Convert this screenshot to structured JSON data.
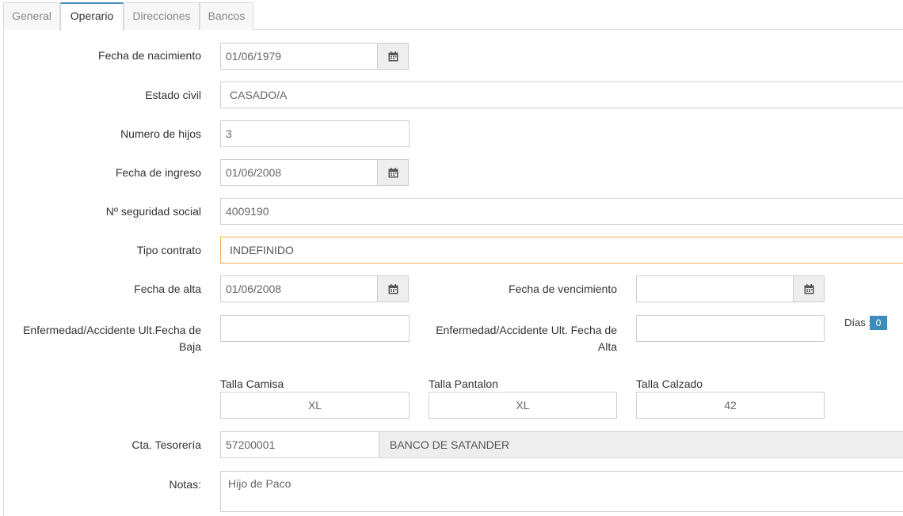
{
  "tabs": [
    "General",
    "Operario",
    "Direcciones",
    "Bancos"
  ],
  "fields": {
    "fecha_nacimiento": {
      "label": "Fecha de nacimiento",
      "value": "01/06/1979"
    },
    "estado_civil": {
      "label": "Estado civil",
      "value": "CASADO/A"
    },
    "numero_hijos": {
      "label": "Numero de hijos",
      "value": "3"
    },
    "fecha_ingreso": {
      "label": "Fecha de ingreso",
      "value": "01/06/2008"
    },
    "seguridad_social": {
      "label": "Nº seguridad social",
      "value": "4009190"
    },
    "tipo_contrato": {
      "label": "Tipo contrato",
      "value": "INDEFINIDO"
    },
    "fecha_alta": {
      "label": "Fecha de alta",
      "value": "01/06/2008"
    },
    "fecha_vencimiento": {
      "label": "Fecha de vencimiento",
      "value": ""
    },
    "enf_baja": {
      "label_1": "Enfermedad/Accidente Ult.Fecha de",
      "label_2": "Baja",
      "value": ""
    },
    "enf_alta": {
      "label_1": "Enfermedad/Accidente Ult. Fecha de",
      "label_2": "Alta",
      "value": ""
    },
    "dias": {
      "label": "Días :",
      "value": "0"
    },
    "talla_camisa": {
      "label": "Talla Camisa",
      "value": "XL"
    },
    "talla_pantalon": {
      "label": "Talla Pantalon",
      "value": "XL"
    },
    "talla_calzado": {
      "label": "Talla Calzado",
      "value": "42"
    },
    "cta_tesoreria": {
      "label": "Cta. Tesorería",
      "value": "57200001",
      "bank": "BANCO DE SATANDER"
    },
    "notas": {
      "label": "Notas:",
      "value": "Hijo de Paco"
    }
  },
  "icons": {
    "calendar": "calendar-icon"
  },
  "colors": {
    "accent": "#3c8dbc",
    "focus": "#f0ad4e"
  }
}
